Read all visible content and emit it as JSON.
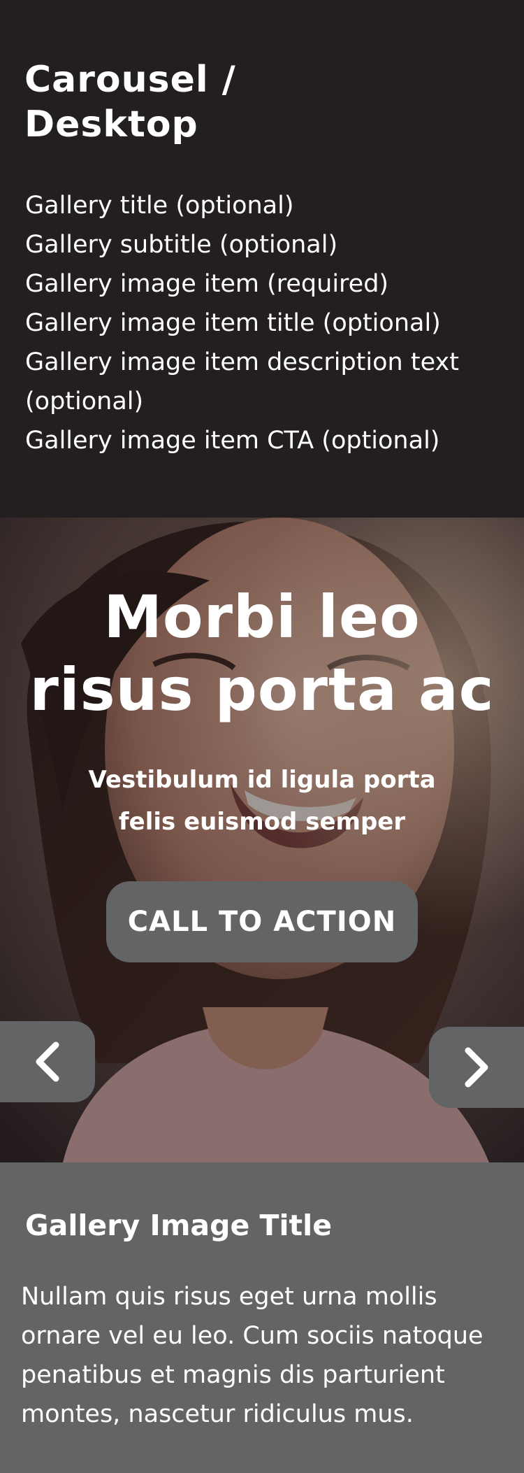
{
  "header": {
    "title": "Carousel / Desktop",
    "spec_items": [
      "Gallery title (optional)",
      "Gallery subtitle (optional)",
      "Gallery image item (required)",
      "Gallery image item title (optional)",
      "Gallery image item description text (optional)",
      "Gallery image item CTA (optional)"
    ]
  },
  "slide": {
    "title": "Morbi leo risus porta ac",
    "subtitle": "Vestibulum id ligula porta felis euismod semper",
    "cta_label": "CALL TO ACTION"
  },
  "nav": {
    "prev_icon": "chevron-left-icon",
    "next_icon": "chevron-right-icon"
  },
  "caption": {
    "title": "Gallery Image Title",
    "text": "Nullam quis risus eget urna mollis ornare vel eu leo. Cum sociis natoque penatibus et magnis dis parturient montes, nascetur ridiculus mus."
  },
  "colors": {
    "page_background": "#231f20",
    "button_background": "#636466",
    "caption_background": "#636466",
    "text": "#ffffff"
  }
}
